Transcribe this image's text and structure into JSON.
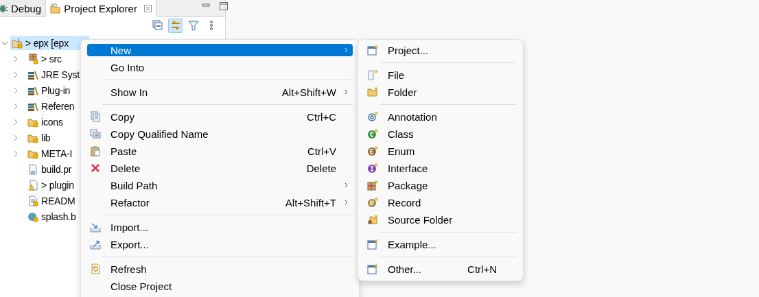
{
  "tabs": [
    {
      "label": "Debug",
      "kind": "debug",
      "selected": false,
      "closable": false
    },
    {
      "label": "Project Explorer",
      "kind": "explorer",
      "selected": true,
      "closable": true
    }
  ],
  "view_toolbar": [
    {
      "kind": "collapse",
      "on": false
    },
    {
      "kind": "link",
      "on": true
    },
    {
      "kind": "filter",
      "on": false
    },
    {
      "kind": "more",
      "on": false
    }
  ],
  "tree": [
    {
      "label": "> epx [epx",
      "kind": "project",
      "selected": true,
      "expanded": true,
      "children": [
        {
          "label": "> src",
          "kind": "source",
          "selected": false,
          "expanded": false
        },
        {
          "label": "JRE Syst",
          "kind": "library",
          "selected": false,
          "expanded": false
        },
        {
          "label": "Plug-in",
          "kind": "library",
          "selected": false,
          "expanded": false
        },
        {
          "label": "Referen",
          "kind": "library",
          "selected": false,
          "expanded": false
        },
        {
          "label": "icons",
          "kind": "folder",
          "selected": false,
          "expanded": false
        },
        {
          "label": "lib",
          "kind": "folder",
          "selected": false,
          "expanded": false
        },
        {
          "label": "META-I",
          "kind": "folder",
          "selected": false,
          "expanded": false
        },
        {
          "label": "build.pr",
          "kind": "properties",
          "selected": false
        },
        {
          "label": "> plugin",
          "kind": "plugin",
          "selected": false
        },
        {
          "label": "READM",
          "kind": "text",
          "selected": false
        },
        {
          "label": "splash.b",
          "kind": "image",
          "selected": false
        }
      ]
    }
  ],
  "context_menu": [
    {
      "kind": "plain",
      "label": "New",
      "selected": true,
      "submenu": true
    },
    {
      "kind": "plain",
      "label": "Go Into",
      "selected": false,
      "submenu": false
    },
    {
      "kind": "separator"
    },
    {
      "kind": "plain",
      "label": "Show In",
      "shortcut": "Alt+Shift+W",
      "selected": false,
      "submenu": true
    },
    {
      "kind": "separator"
    },
    {
      "kind": "copy",
      "label": "Copy",
      "shortcut": "Ctrl+C",
      "selected": false,
      "submenu": false
    },
    {
      "kind": "copy-name",
      "label": "Copy Qualified Name",
      "selected": false,
      "submenu": false
    },
    {
      "kind": "paste",
      "label": "Paste",
      "shortcut": "Ctrl+V",
      "selected": false,
      "submenu": false
    },
    {
      "kind": "delete",
      "label": "Delete",
      "shortcut": "Delete",
      "selected": false,
      "submenu": false
    },
    {
      "kind": "plain",
      "label": "Build Path",
      "selected": false,
      "submenu": true
    },
    {
      "kind": "plain",
      "label": "Refactor",
      "shortcut": "Alt+Shift+T",
      "selected": false,
      "submenu": true
    },
    {
      "kind": "separator"
    },
    {
      "kind": "import",
      "label": "Import...",
      "selected": false,
      "submenu": false
    },
    {
      "kind": "export",
      "label": "Export...",
      "selected": false,
      "submenu": false
    },
    {
      "kind": "separator"
    },
    {
      "kind": "refresh",
      "label": "Refresh",
      "selected": false,
      "submenu": false
    },
    {
      "kind": "plain",
      "label": "Close Project",
      "selected": false,
      "submenu": false
    }
  ],
  "new_submenu": [
    {
      "kind": "wizard",
      "label": "Project...",
      "selected": false
    },
    {
      "kind": "separator"
    },
    {
      "kind": "file",
      "label": "File",
      "selected": false
    },
    {
      "kind": "folder",
      "label": "Folder",
      "selected": false
    },
    {
      "kind": "separator"
    },
    {
      "kind": "annotation",
      "label": "Annotation",
      "selected": false
    },
    {
      "kind": "class",
      "label": "Class",
      "selected": false
    },
    {
      "kind": "enum",
      "label": "Enum",
      "selected": false
    },
    {
      "kind": "interface",
      "label": "Interface",
      "selected": false
    },
    {
      "kind": "package",
      "label": "Package",
      "selected": false
    },
    {
      "kind": "record",
      "label": "Record",
      "selected": false
    },
    {
      "kind": "source-folder",
      "label": "Source Folder",
      "selected": false
    },
    {
      "kind": "separator"
    },
    {
      "kind": "wizard",
      "label": "Example...",
      "selected": false
    },
    {
      "kind": "separator"
    },
    {
      "kind": "wizard",
      "label": "Other...",
      "shortcut": "Ctrl+N",
      "selected": false
    }
  ]
}
